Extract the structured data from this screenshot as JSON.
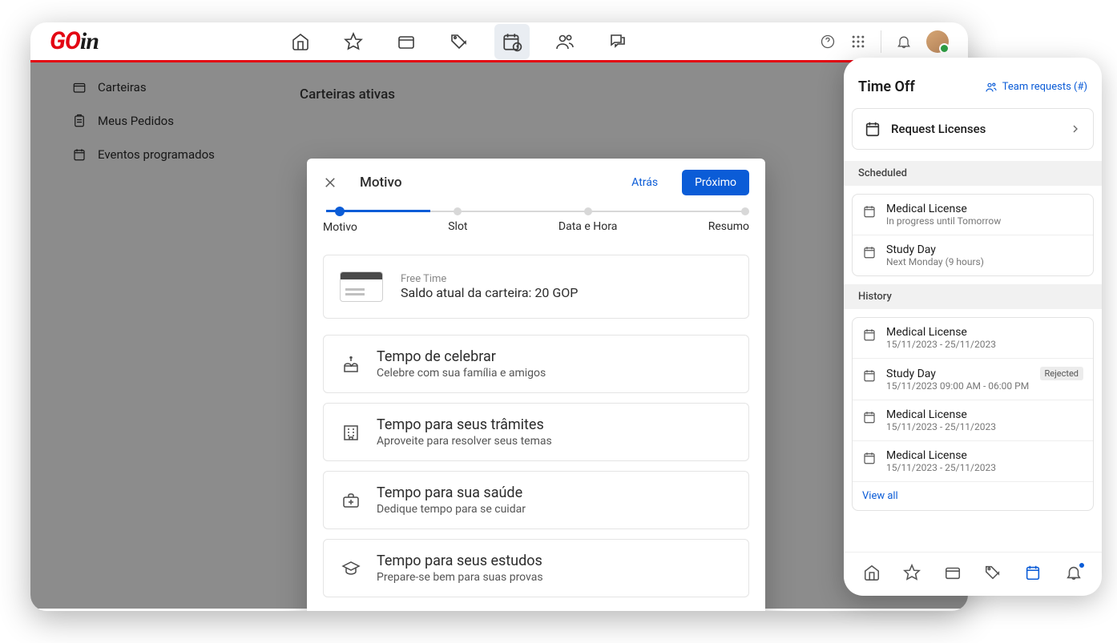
{
  "header": {
    "logo_go": "GO",
    "logo_in": "in"
  },
  "sidebar": {
    "items": [
      {
        "label": "Carteiras"
      },
      {
        "label": "Meus Pedidos"
      },
      {
        "label": "Eventos programados"
      }
    ]
  },
  "page": {
    "title": "Carteiras ativas"
  },
  "modal": {
    "title": "Motivo",
    "back": "Atrás",
    "next": "Próximo",
    "steps": [
      "Motivo",
      "Slot",
      "Data e Hora",
      "Resumo"
    ],
    "balance": {
      "label": "Free Time",
      "text": "Saldo atual da carteira: 20 GOP"
    },
    "reasons": [
      {
        "title": "Tempo de celebrar",
        "sub": "Celebre com sua família e amigos"
      },
      {
        "title": "Tempo para seus trâmites",
        "sub": "Aproveite para resolver seus temas"
      },
      {
        "title": "Tempo para sua saúde",
        "sub": "Dedique tempo para se cuidar"
      },
      {
        "title": "Tempo para seus estudos",
        "sub": "Prepare-se bem para suas provas"
      }
    ]
  },
  "mobile": {
    "title": "Time Off",
    "team_requests": "Team requests (#)",
    "request_licenses": "Request Licenses",
    "scheduled_header": "Scheduled",
    "scheduled": [
      {
        "name": "Medical License",
        "sub": "In progress until Tomorrow"
      },
      {
        "name": "Study Day",
        "sub": "Next Monday (9 hours)"
      }
    ],
    "history_header": "History",
    "history": [
      {
        "name": "Medical License",
        "sub": "15/11/2023 - 25/11/2023",
        "badge": ""
      },
      {
        "name": "Study Day",
        "sub": "15/11/2023   09:00 AM - 06:00 PM",
        "badge": "Rejected"
      },
      {
        "name": "Medical License",
        "sub": "15/11/2023 - 25/11/2023",
        "badge": ""
      },
      {
        "name": "Medical License",
        "sub": "15/11/2023 - 25/11/2023",
        "badge": ""
      }
    ],
    "view_all": "View all"
  }
}
